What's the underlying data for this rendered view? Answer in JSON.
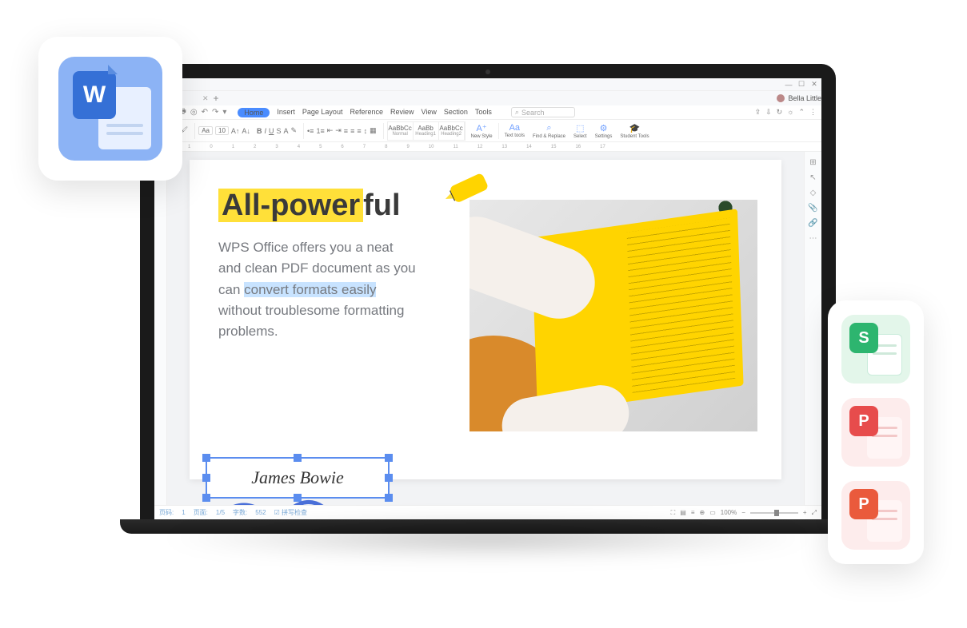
{
  "user": {
    "name": "Bella Little"
  },
  "menus": {
    "home": "Home",
    "items": [
      "Insert",
      "Page Layout",
      "Reference",
      "Review",
      "View",
      "Section",
      "Tools"
    ]
  },
  "search": {
    "placeholder": "Search"
  },
  "ribbon": {
    "font_family": "Aa",
    "font_size": "10",
    "style_normal_preview": "AaBbCc",
    "style_normal_name": "Normal",
    "style_heading1_preview": "AaBb",
    "style_heading1_name": "Heading1",
    "style_heading2_preview": "AaBbCc",
    "style_heading2_name": "Heading2",
    "tool_new_style": "New Style",
    "tool_text_tools": "Text tools",
    "tool_find_replace": "Find & Replace",
    "tool_select": "Select",
    "tool_settings": "Settings",
    "tool_student": "Student Tools"
  },
  "ruler": [
    "1",
    "0",
    "1",
    "2",
    "3",
    "4",
    "5",
    "6",
    "7",
    "8",
    "9",
    "10",
    "11",
    "12",
    "13",
    "14",
    "15",
    "16",
    "17"
  ],
  "doc": {
    "headline_hl": "All-power",
    "headline_rest": "ful",
    "body_before": "WPS Office offers you a neat and clean PDF document as you can ",
    "body_hl": "convert formats easily",
    "body_after": " without troublesome formatting problems.",
    "signature": "James Bowie"
  },
  "status": {
    "page_label": "页码:",
    "page_value": "1",
    "pages_label": "页面:",
    "pages_value": "1/5",
    "words_label": "字数:",
    "words_value": "552",
    "spellcheck": "拼写检查",
    "zoom": "100%"
  },
  "icons": {
    "writer_letter": "W",
    "sheets_letter": "S",
    "pdf_letter": "P",
    "pres_letter": "P"
  }
}
